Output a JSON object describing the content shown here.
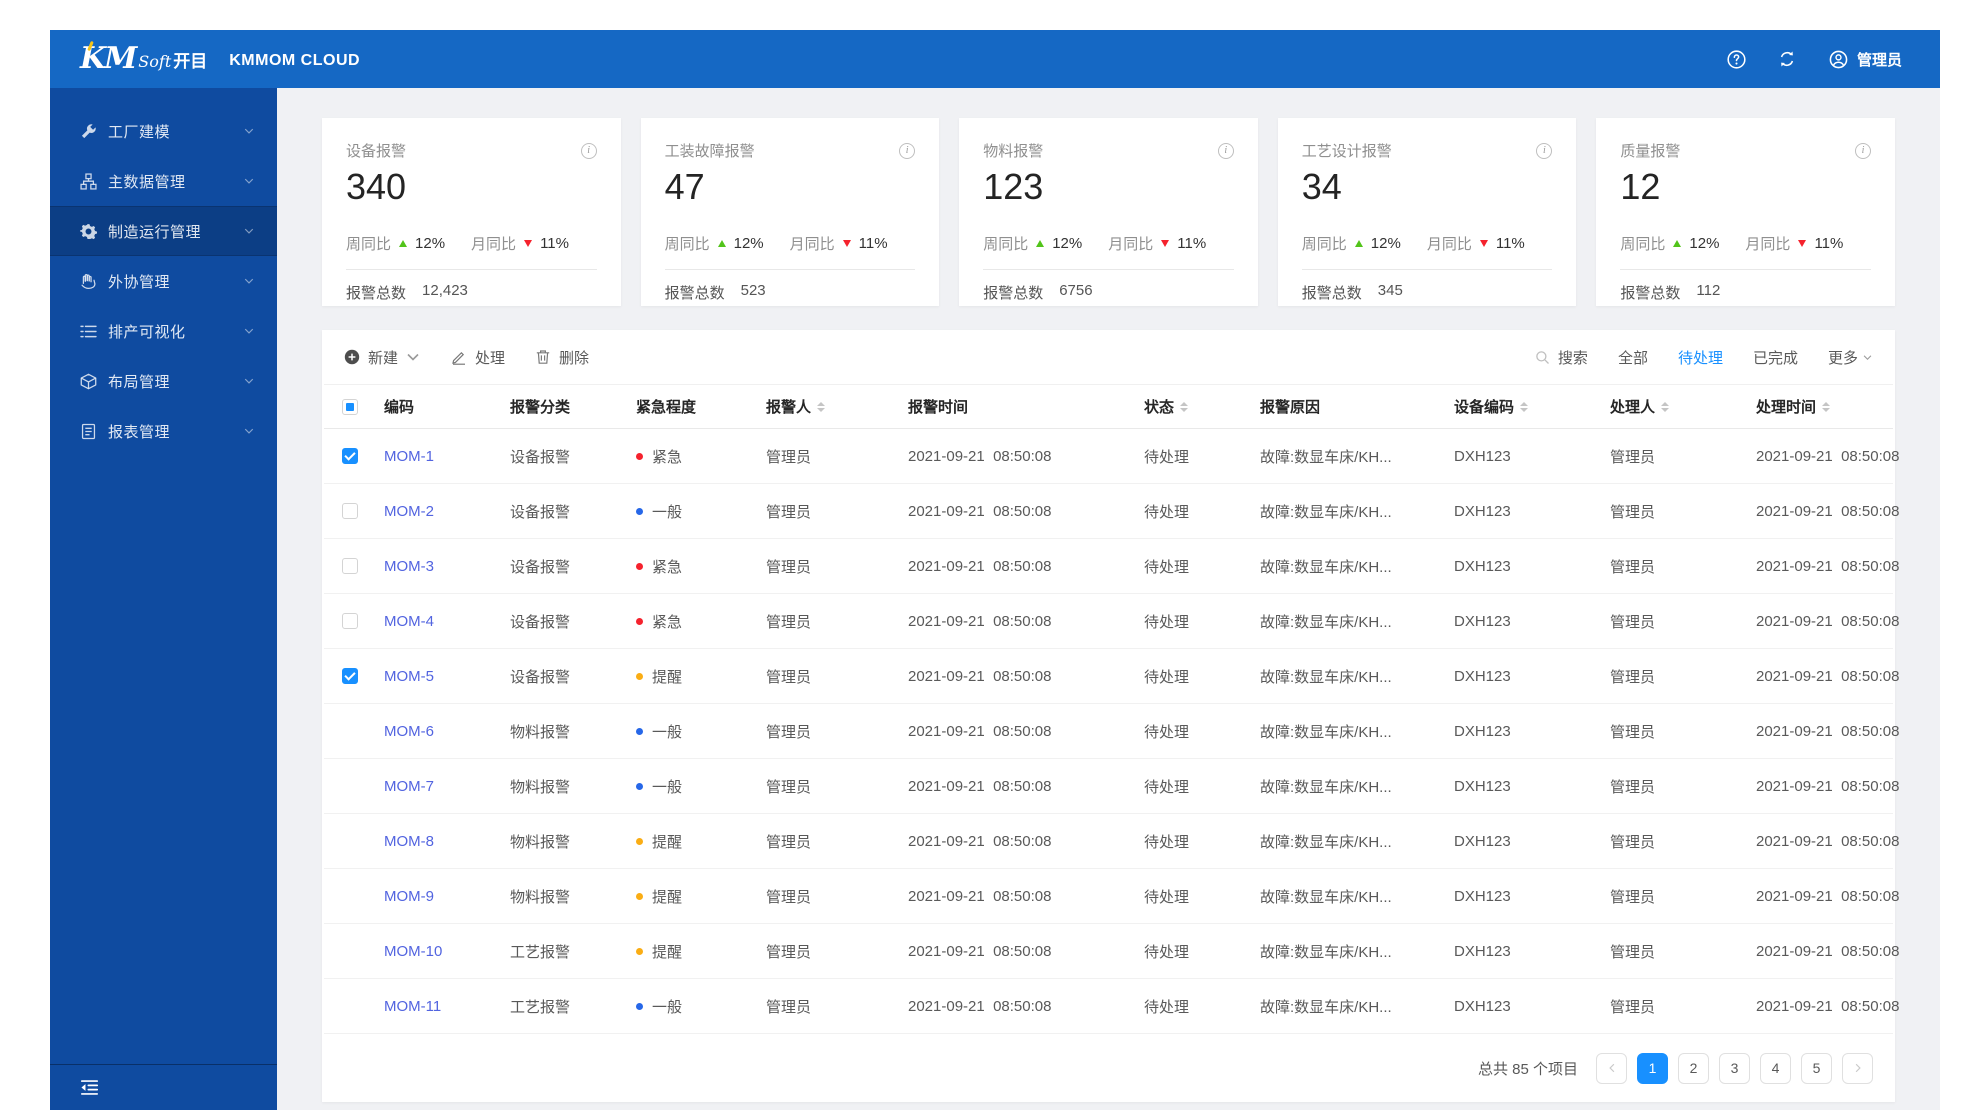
{
  "header": {
    "logo_km": "KM",
    "logo_soft": "Soft",
    "logo_cn": "开目",
    "product_name": "KMMOM CLOUD",
    "user_name": "管理员",
    "icons": [
      "help-icon",
      "refresh-icon",
      "user-icon"
    ]
  },
  "sidebar": {
    "items": [
      {
        "label": "工厂建模",
        "icon": "wrench-icon",
        "active": false
      },
      {
        "label": "主数据管理",
        "icon": "nodes-icon",
        "active": false
      },
      {
        "label": "制造运行管理",
        "icon": "gear-icon",
        "active": true
      },
      {
        "label": "外协管理",
        "icon": "hand-icon",
        "active": false
      },
      {
        "label": "排产可视化",
        "icon": "list-icon",
        "active": false
      },
      {
        "label": "布局管理",
        "icon": "cube-icon",
        "active": false
      },
      {
        "label": "报表管理",
        "icon": "report-icon",
        "active": false
      }
    ],
    "collapse_icon": "menu-fold-icon"
  },
  "stat_cards": [
    {
      "title": "设备报警",
      "value": "340",
      "week_label": "周同比",
      "week_value": "12%",
      "week_dir": "up",
      "month_label": "月同比",
      "month_value": "11%",
      "month_dir": "down",
      "total_label": "报警总数",
      "total_value": "12,423"
    },
    {
      "title": "工装故障报警",
      "value": "47",
      "week_label": "周同比",
      "week_value": "12%",
      "week_dir": "up",
      "month_label": "月同比",
      "month_value": "11%",
      "month_dir": "down",
      "total_label": "报警总数",
      "total_value": "523"
    },
    {
      "title": "物料报警",
      "value": "123",
      "week_label": "周同比",
      "week_value": "12%",
      "week_dir": "up",
      "month_label": "月同比",
      "month_value": "11%",
      "month_dir": "down",
      "total_label": "报警总数",
      "total_value": "6756"
    },
    {
      "title": "工艺设计报警",
      "value": "34",
      "week_label": "周同比",
      "week_value": "12%",
      "week_dir": "up",
      "month_label": "月同比",
      "month_value": "11%",
      "month_dir": "down",
      "total_label": "报警总数",
      "total_value": "345"
    },
    {
      "title": "质量报警",
      "value": "12",
      "week_label": "周同比",
      "week_value": "12%",
      "week_dir": "up",
      "month_label": "月同比",
      "month_value": "11%",
      "month_dir": "down",
      "total_label": "报警总数",
      "total_value": "112"
    }
  ],
  "toolbar": {
    "new_label": "新建",
    "process_label": "处理",
    "delete_label": "删除",
    "search_label": "搜索",
    "filters": [
      {
        "label": "全部",
        "active": false
      },
      {
        "label": "待处理",
        "active": true
      },
      {
        "label": "已完成",
        "active": false
      }
    ],
    "more_label": "更多"
  },
  "table": {
    "columns": [
      {
        "label": "编码",
        "sortable": false
      },
      {
        "label": "报警分类",
        "sortable": false
      },
      {
        "label": "紧急程度",
        "sortable": false
      },
      {
        "label": "报警人",
        "sortable": true
      },
      {
        "label": "报警时间",
        "sortable": false
      },
      {
        "label": "状态",
        "sortable": true
      },
      {
        "label": "报警原因",
        "sortable": false
      },
      {
        "label": "设备编码",
        "sortable": true
      },
      {
        "label": "处理人",
        "sortable": true
      },
      {
        "label": "处理时间",
        "sortable": true
      }
    ],
    "rows": [
      {
        "code": "MOM-1",
        "category": "设备报警",
        "urgency": "紧急",
        "urgency_level": "urgent",
        "reporter": "管理员",
        "alarm_time": "2021-09-21  08:50:08",
        "status": "待处理",
        "reason": "故障:数显车床/KH...",
        "device_code": "DXH123",
        "handler": "管理员",
        "handle_time": "2021-09-21  08:50:08",
        "checkbox": "checked"
      },
      {
        "code": "MOM-2",
        "category": "设备报警",
        "urgency": "一般",
        "urgency_level": "normal",
        "reporter": "管理员",
        "alarm_time": "2021-09-21  08:50:08",
        "status": "待处理",
        "reason": "故障:数显车床/KH...",
        "device_code": "DXH123",
        "handler": "管理员",
        "handle_time": "2021-09-21  08:50:08",
        "checkbox": "unchecked"
      },
      {
        "code": "MOM-3",
        "category": "设备报警",
        "urgency": "紧急",
        "urgency_level": "urgent",
        "reporter": "管理员",
        "alarm_time": "2021-09-21  08:50:08",
        "status": "待处理",
        "reason": "故障:数显车床/KH...",
        "device_code": "DXH123",
        "handler": "管理员",
        "handle_time": "2021-09-21  08:50:08",
        "checkbox": "unchecked"
      },
      {
        "code": "MOM-4",
        "category": "设备报警",
        "urgency": "紧急",
        "urgency_level": "urgent",
        "reporter": "管理员",
        "alarm_time": "2021-09-21  08:50:08",
        "status": "待处理",
        "reason": "故障:数显车床/KH...",
        "device_code": "DXH123",
        "handler": "管理员",
        "handle_time": "2021-09-21  08:50:08",
        "checkbox": "unchecked"
      },
      {
        "code": "MOM-5",
        "category": "设备报警",
        "urgency": "提醒",
        "urgency_level": "remind",
        "reporter": "管理员",
        "alarm_time": "2021-09-21  08:50:08",
        "status": "待处理",
        "reason": "故障:数显车床/KH...",
        "device_code": "DXH123",
        "handler": "管理员",
        "handle_time": "2021-09-21  08:50:08",
        "checkbox": "checked"
      },
      {
        "code": "MOM-6",
        "category": "物料报警",
        "urgency": "一般",
        "urgency_level": "normal",
        "reporter": "管理员",
        "alarm_time": "2021-09-21  08:50:08",
        "status": "待处理",
        "reason": "故障:数显车床/KH...",
        "device_code": "DXH123",
        "handler": "管理员",
        "handle_time": "2021-09-21  08:50:08",
        "checkbox": "none"
      },
      {
        "code": "MOM-7",
        "category": "物料报警",
        "urgency": "一般",
        "urgency_level": "normal",
        "reporter": "管理员",
        "alarm_time": "2021-09-21  08:50:08",
        "status": "待处理",
        "reason": "故障:数显车床/KH...",
        "device_code": "DXH123",
        "handler": "管理员",
        "handle_time": "2021-09-21  08:50:08",
        "checkbox": "none"
      },
      {
        "code": "MOM-8",
        "category": "物料报警",
        "urgency": "提醒",
        "urgency_level": "remind",
        "reporter": "管理员",
        "alarm_time": "2021-09-21  08:50:08",
        "status": "待处理",
        "reason": "故障:数显车床/KH...",
        "device_code": "DXH123",
        "handler": "管理员",
        "handle_time": "2021-09-21  08:50:08",
        "checkbox": "none"
      },
      {
        "code": "MOM-9",
        "category": "物料报警",
        "urgency": "提醒",
        "urgency_level": "remind",
        "reporter": "管理员",
        "alarm_time": "2021-09-21  08:50:08",
        "status": "待处理",
        "reason": "故障:数显车床/KH...",
        "device_code": "DXH123",
        "handler": "管理员",
        "handle_time": "2021-09-21  08:50:08",
        "checkbox": "none"
      },
      {
        "code": "MOM-10",
        "category": "工艺报警",
        "urgency": "提醒",
        "urgency_level": "remind",
        "reporter": "管理员",
        "alarm_time": "2021-09-21  08:50:08",
        "status": "待处理",
        "reason": "故障:数显车床/KH...",
        "device_code": "DXH123",
        "handler": "管理员",
        "handle_time": "2021-09-21  08:50:08",
        "checkbox": "none"
      },
      {
        "code": "MOM-11",
        "category": "工艺报警",
        "urgency": "一般",
        "urgency_level": "normal",
        "reporter": "管理员",
        "alarm_time": "2021-09-21  08:50:08",
        "status": "待处理",
        "reason": "故障:数显车床/KH...",
        "device_code": "DXH123",
        "handler": "管理员",
        "handle_time": "2021-09-21  08:50:08",
        "checkbox": "none"
      }
    ]
  },
  "pagination": {
    "total_text": "总共 85 个项目",
    "pages": [
      "1",
      "2",
      "3",
      "4",
      "5"
    ],
    "active_page": "1"
  },
  "colors": {
    "header_bg": "#1568c4",
    "sidebar_bg": "#0f4ba0",
    "accent_blue": "#1890ff",
    "link_blue": "#5264e0",
    "trend_up_green": "#52c41a",
    "trend_down_red": "#f5222d",
    "urgency": {
      "urgent": "#f5222d",
      "normal": "#2667e8",
      "remind": "#faad14"
    }
  }
}
